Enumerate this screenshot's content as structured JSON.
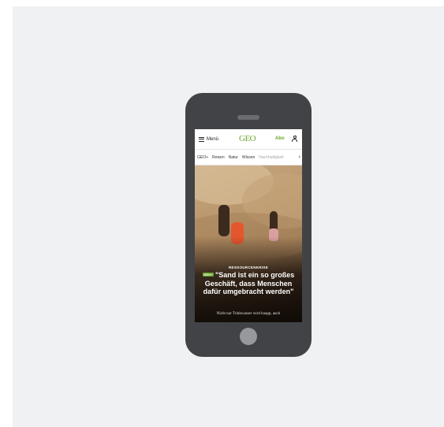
{
  "header": {
    "menu_label": "Menü",
    "logo": "GEO",
    "subscribe_label": "Abo"
  },
  "nav": {
    "items": [
      "GEO+",
      "Reisen",
      "Natur",
      "Wissen",
      "Nachhaltigkeit"
    ]
  },
  "article": {
    "kicker": "RESSOURCENKRISE",
    "badge": "GEO+",
    "headline": "\"Sand ist ein so großes Geschäft, dass Menschen dafür umgebracht werden\"",
    "teaser": "Nicht nur Trinkwasser wird knapp, auch"
  },
  "colors": {
    "brand_green": "#6aa62e",
    "device": "#424346",
    "background": "#f0f1f3"
  },
  "icons": [
    "hamburger-icon",
    "user-icon",
    "chevron-right-icon"
  ]
}
